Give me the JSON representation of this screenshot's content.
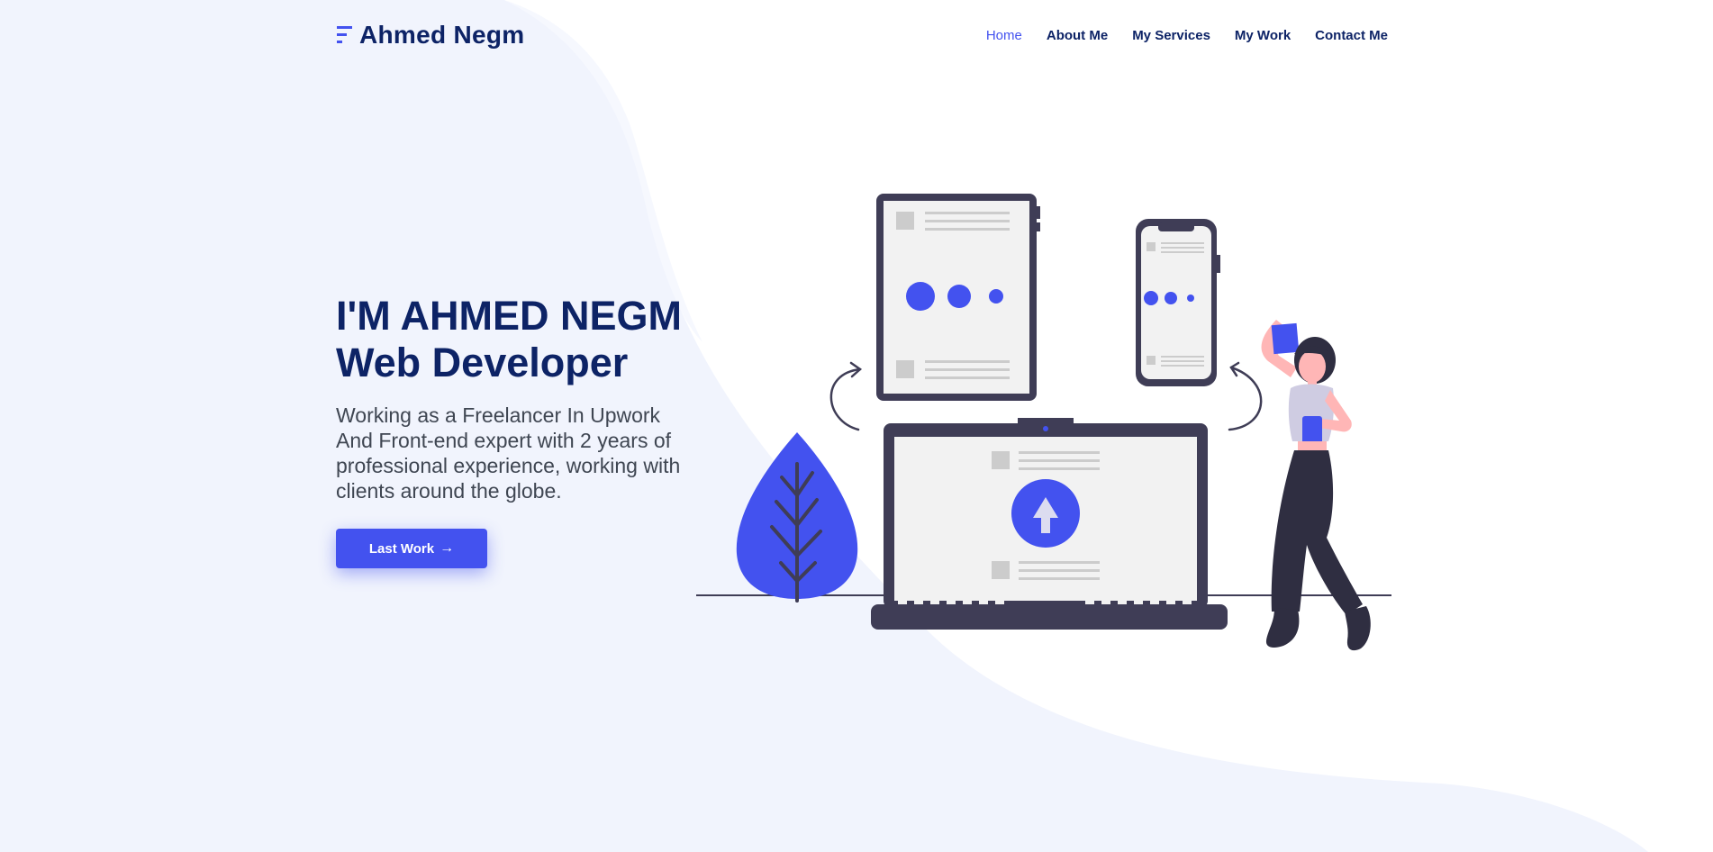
{
  "brand": {
    "name": "Ahmed Negm",
    "icon": "menu-lines-icon",
    "color": "#0d2366"
  },
  "nav": {
    "items": [
      {
        "label": "Home",
        "active": true
      },
      {
        "label": "About Me",
        "active": false
      },
      {
        "label": "My Services",
        "active": false
      },
      {
        "label": "My Work",
        "active": false
      },
      {
        "label": "Contact Me",
        "active": false
      }
    ]
  },
  "hero": {
    "title_line1": "I'M AHMED NEGM",
    "title_line2": "Web Developer",
    "description": "Working as a Freelancer In Upwork And Front-end expert with 2 years of professional experience, working with clients around the globe.",
    "button_label": "Last Work",
    "button_icon": "arrow-right-icon"
  },
  "colors": {
    "accent": "#4352ef",
    "dark_navy": "#0d2366",
    "background_wave": "#f1f4fd",
    "device_dark": "#3f3d56",
    "skin": "#ffb6b6"
  }
}
